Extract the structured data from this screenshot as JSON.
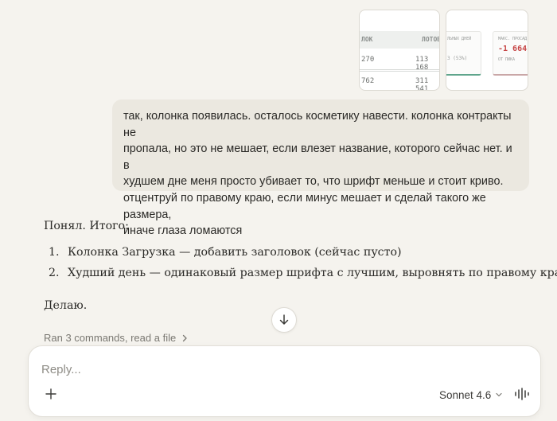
{
  "thumbnails": {
    "first": {
      "headers": [
        "ЛОК",
        "ЛОТОВ"
      ],
      "rows": [
        [
          "270",
          "113 168"
        ],
        [
          "762",
          "311 541"
        ]
      ]
    },
    "second": {
      "card_a_top": "ЛЬНЫХ ДНЕЙ",
      "card_a_value": "3 (53%)",
      "card_b_top": "МАКС. ПРОСАД",
      "card_b_value": "-1 664",
      "card_b_bottom": "ОТ ПИКА"
    }
  },
  "user_message": {
    "lines": [
      "так, колонка появилась. осталось косметику навести. колонка контракты не",
      "пропала, но это не мешает, если влезет название, которого сейчас нет. и в",
      "худшем дне меня просто убивает то, что шрифт меньше и стоит криво.",
      "отцентруй по правому краю, если минус мешает и сделай такого же размера,",
      "иначе глаза ломаются"
    ]
  },
  "assistant_message": {
    "intro": "Понял. Итого:",
    "items": [
      {
        "num": "1.",
        "text": "Колонка Загрузка — добавить заголовок (сейчас пусто)"
      },
      {
        "num": "2.",
        "text": "Худший день — одинаковый размер шрифта с лучшим, выровнять по правому краю"
      }
    ],
    "outro": "Делаю."
  },
  "tool_summary": {
    "label": "Ran 3 commands, read a file"
  },
  "composer": {
    "placeholder": "Reply...",
    "model": "Sonnet 4.6"
  },
  "icons": {
    "scroll": "arrow-down-icon",
    "add": "plus-icon",
    "model": "chevron-down-icon",
    "voice": "waveform-icon",
    "tool": "chevron-right-icon"
  }
}
